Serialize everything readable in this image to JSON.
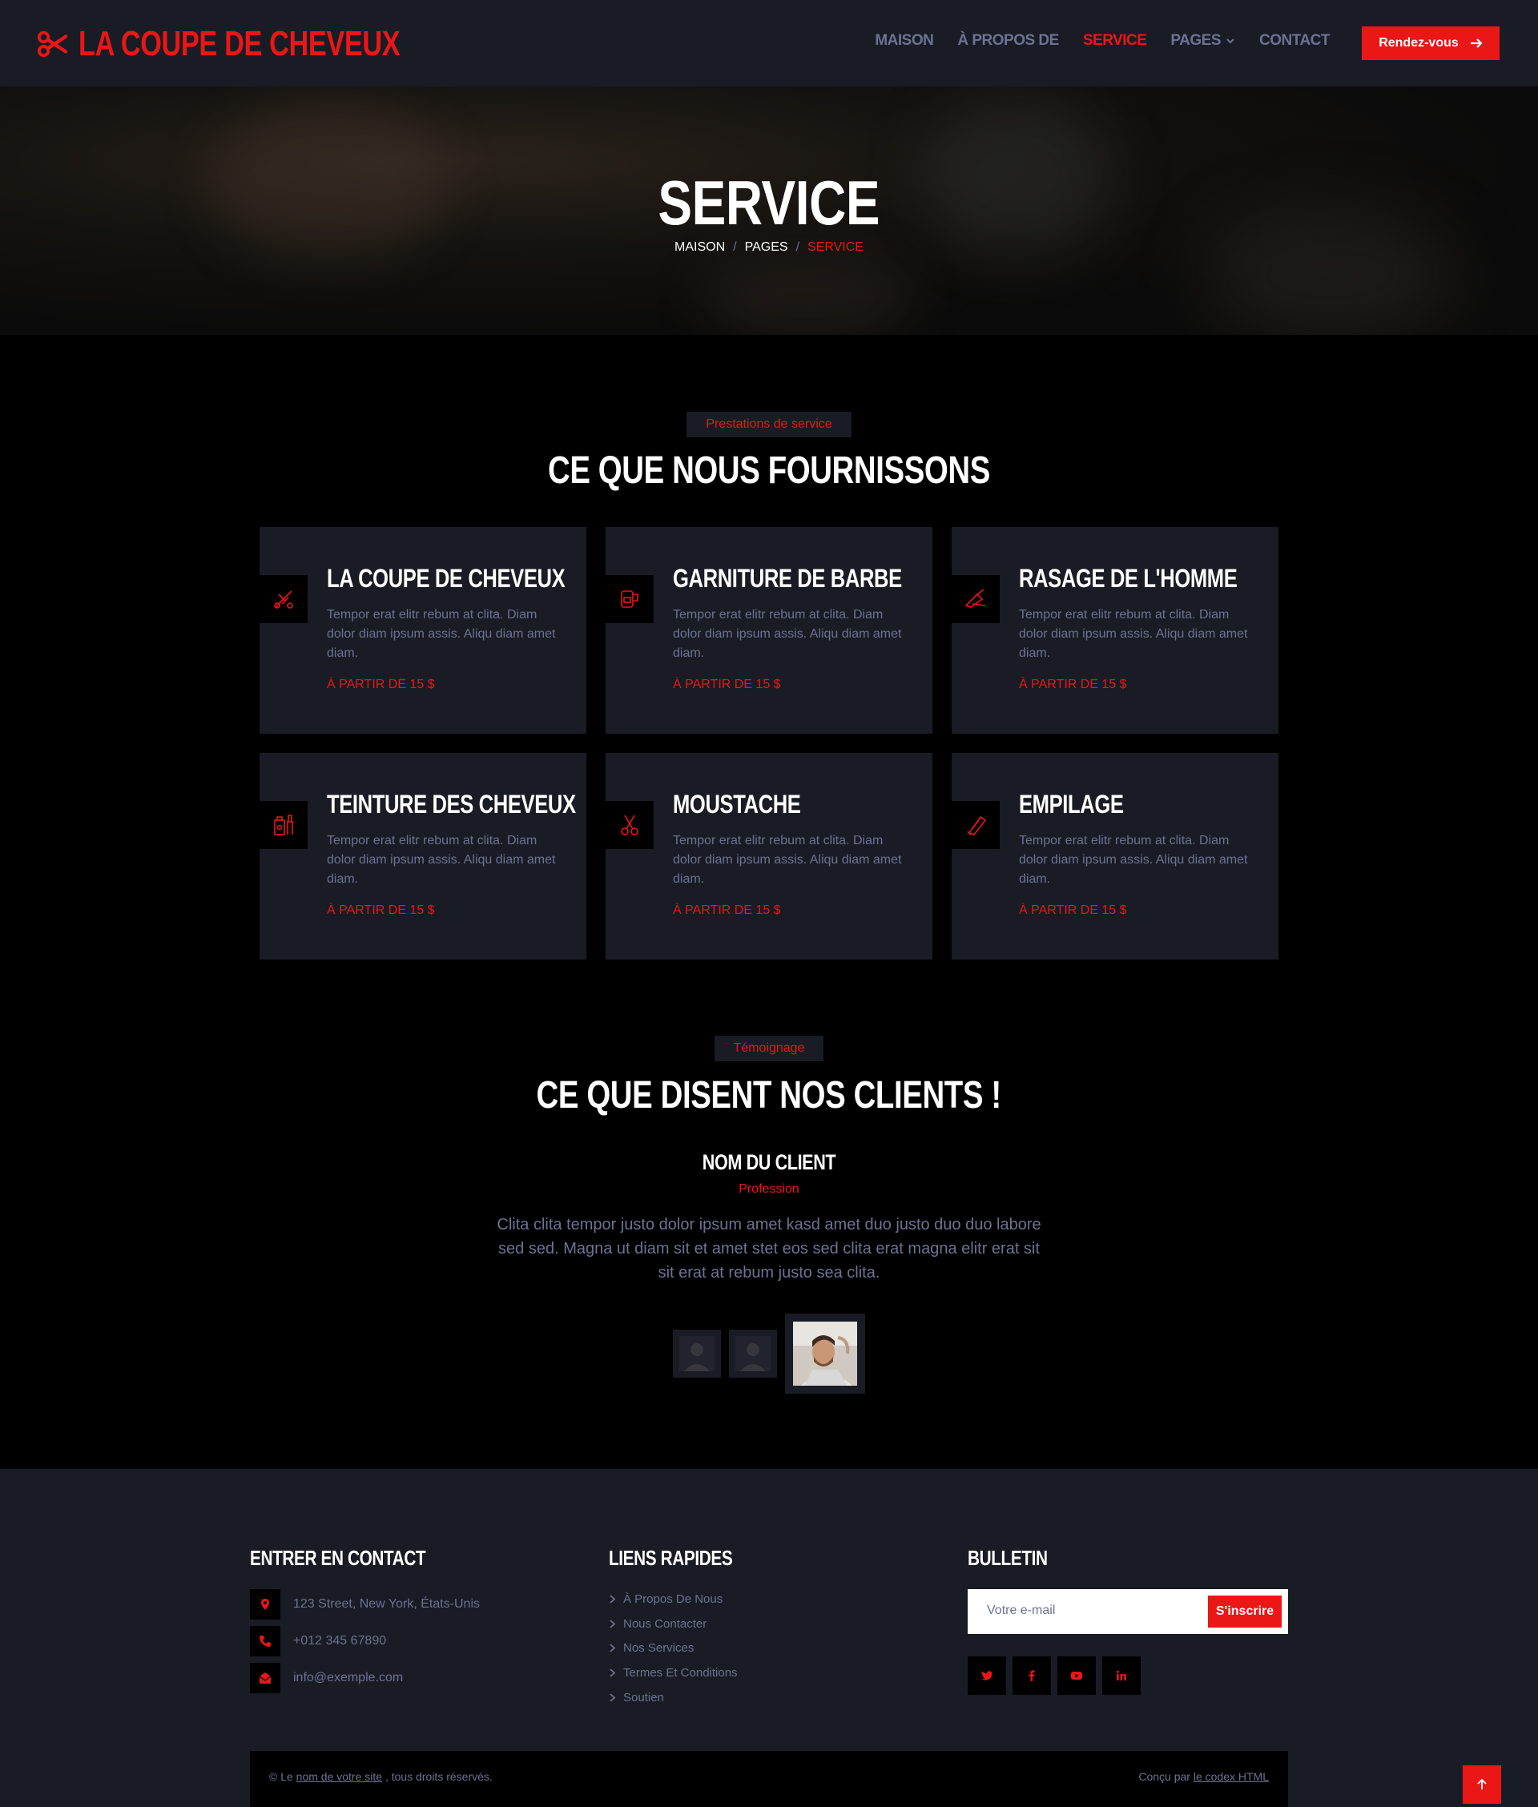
{
  "brand": {
    "name": "LA COUPE DE CHEVEUX",
    "icon": "scissors-icon"
  },
  "nav": {
    "items": [
      {
        "label": "MAISON",
        "active": false
      },
      {
        "label": "À PROPOS DE",
        "active": false
      },
      {
        "label": "SERVICE",
        "active": true
      },
      {
        "label": "PAGES",
        "active": false,
        "dropdown": true
      },
      {
        "label": "CONTACT",
        "active": false
      }
    ],
    "cta_label": "Rendez-vous"
  },
  "hero": {
    "title": "SERVICE",
    "breadcrumb": [
      "MAISON",
      "PAGES",
      "SERVICE"
    ]
  },
  "services": {
    "tag": "Prestations de service",
    "title": "CE QUE NOUS FOURNISSONS",
    "cards": [
      {
        "title": "LA COUPE DE CHEVEUX",
        "text": "Tempor erat elitr rebum at clita. Diam dolor diam ipsum assis. Aliqu diam amet diam.",
        "price": "À PARTIR DE 15 $",
        "icon": "haircut-icon"
      },
      {
        "title": "GARNITURE DE BARBE",
        "text": "Tempor erat elitr rebum at clita. Diam dolor diam ipsum assis. Aliqu diam amet diam.",
        "price": "À PARTIR DE 15 $",
        "icon": "beard-trimmer-icon"
      },
      {
        "title": "RASAGE DE L'HOMME",
        "text": "Tempor erat elitr rebum at clita. Diam dolor diam ipsum assis. Aliqu diam amet diam.",
        "price": "À PARTIR DE 15 $",
        "icon": "razor-icon"
      },
      {
        "title": "TEINTURE DES CHEVEUX",
        "text": "Tempor erat elitr rebum at clita. Diam dolor diam ipsum assis. Aliqu diam amet diam.",
        "price": "À PARTIR DE 15 $",
        "icon": "hair-dye-icon"
      },
      {
        "title": "MOUSTACHE",
        "text": "Tempor erat elitr rebum at clita. Diam dolor diam ipsum assis. Aliqu diam amet diam.",
        "price": "À PARTIR DE 15 $",
        "icon": "scissors-icon"
      },
      {
        "title": "EMPILAGE",
        "text": "Tempor erat elitr rebum at clita. Diam dolor diam ipsum assis. Aliqu diam amet diam.",
        "price": "À PARTIR DE 15 $",
        "icon": "clipper-icon"
      }
    ]
  },
  "testimonial": {
    "tag": "Témoignage",
    "title": "CE QUE DISENT NOS CLIENTS !",
    "client_name": "NOM DU CLIENT",
    "profession": "Profession",
    "quote": "Clita clita tempor justo dolor ipsum amet kasd amet duo justo duo duo labore sed sed. Magna ut diam sit et amet stet eos sed clita erat magna elitr erat sit sit erat at rebum justo sea clita."
  },
  "footer": {
    "contact": {
      "title": "ENTRER EN CONTACT",
      "address": "123 Street, New York, États-Unis",
      "phone": "+012 345 67890",
      "email": "info@exemple.com"
    },
    "links": {
      "title": "LIENS RAPIDES",
      "items": [
        "À Propos De Nous",
        "Nous Contacter",
        "Nos Services",
        "Termes Et Conditions",
        "Soutien"
      ]
    },
    "newsletter": {
      "title": "BULLETIN",
      "placeholder": "Votre e-mail",
      "button": "S'inscrire"
    },
    "social": [
      "twitter-icon",
      "facebook-icon",
      "youtube-icon",
      "linkedin-icon"
    ],
    "copyright": {
      "prefix": "© Le",
      "site_link": "nom de votre site",
      "suffix": ", tous droits réservés.",
      "designed_prefix": "Conçu par",
      "designed_link": "le codex HTML"
    }
  },
  "colors": {
    "accent": "#eb1616",
    "dark": "#191c24",
    "muted": "#6c7293",
    "black": "#000000"
  }
}
